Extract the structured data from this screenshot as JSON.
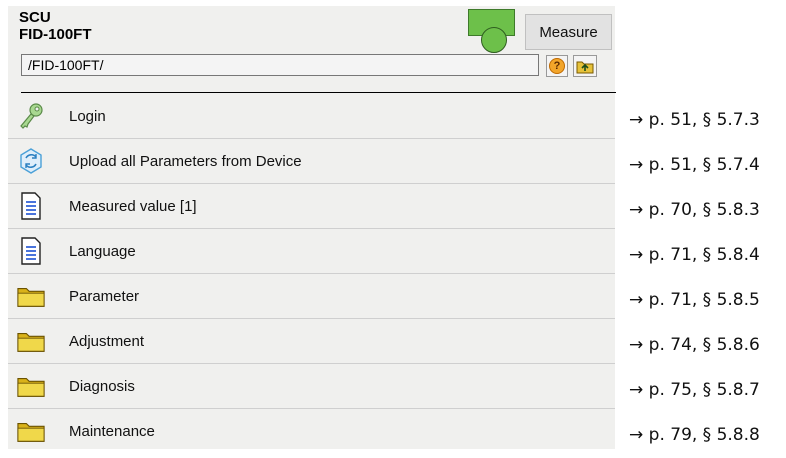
{
  "header": {
    "line1": "SCU",
    "line2": "FID-100FT",
    "measure_label": "Measure",
    "path": "/FID-100FT/",
    "status_color": "#6dc04a"
  },
  "menu": [
    {
      "label": "Login",
      "icon": "key-icon",
      "ref": "→ p. 51, § 5.7.3"
    },
    {
      "label": "Upload all Parameters from Device",
      "icon": "upload-sync-icon",
      "ref": "→ p. 51, § 5.7.4"
    },
    {
      "label": "Measured value [1]",
      "icon": "document-icon",
      "ref": "→ p. 70, § 5.8.3"
    },
    {
      "label": "Language",
      "icon": "document-icon",
      "ref": "→ p. 71, § 5.8.4"
    },
    {
      "label": "Parameter",
      "icon": "folder-icon",
      "ref": "→ p. 71, § 5.8.5"
    },
    {
      "label": "Adjustment",
      "icon": "folder-icon",
      "ref": "→ p. 74, § 5.8.6"
    },
    {
      "label": "Diagnosis",
      "icon": "folder-icon",
      "ref": "→ p. 75, § 5.8.7"
    },
    {
      "label": "Maintenance",
      "icon": "folder-icon",
      "ref": "→ p. 79, § 5.8.8"
    }
  ]
}
